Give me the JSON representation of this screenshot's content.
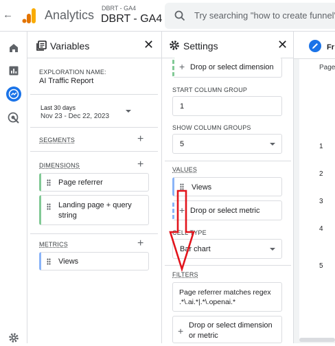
{
  "topbar": {
    "app_name": "Analytics",
    "account_small": "DBRT - GA4",
    "property": "DBRT - GA4",
    "search_placeholder": "Try searching \"how to create funnel\""
  },
  "variables": {
    "title": "Variables",
    "exploration_name_label": "EXPLORATION NAME:",
    "exploration_name": "AI Traffic Report",
    "date_range_label": "Last 30 days",
    "date_range": "Nov 23 - Dec 22, 2023",
    "segments_label": "SEGMENTS",
    "dimensions_label": "DIMENSIONS",
    "dimensions": [
      "Page referrer",
      "Landing page + query string"
    ],
    "metrics_label": "METRICS",
    "metrics": [
      "Views"
    ]
  },
  "settings": {
    "title": "Settings",
    "drop_dimension": "Drop or select dimension",
    "start_column_group_label": "START COLUMN GROUP",
    "start_column_group": "1",
    "show_column_groups_label": "SHOW COLUMN GROUPS",
    "show_column_groups": "5",
    "values_label": "VALUES",
    "value_item": "Views",
    "drop_metric": "Drop or select metric",
    "cell_type_label": "CELL TYPE",
    "cell_type": "Bar chart",
    "filters_label": "FILTERS",
    "filter_text": "Page referrer matches regex .*\\.ai.*|.*\\.openai.*",
    "drop_dimension_or_metric": "Drop or select dimension or metric"
  },
  "canvas": {
    "tab_label": "Fr",
    "header_label": "Page",
    "row_numbers": [
      "1",
      "2",
      "3",
      "4",
      "5"
    ]
  },
  "colors": {
    "accent": "#1a73e8",
    "arrow": "#e2141c",
    "dimension_border": "#81c995",
    "metric_border": "#8ab4f8"
  }
}
